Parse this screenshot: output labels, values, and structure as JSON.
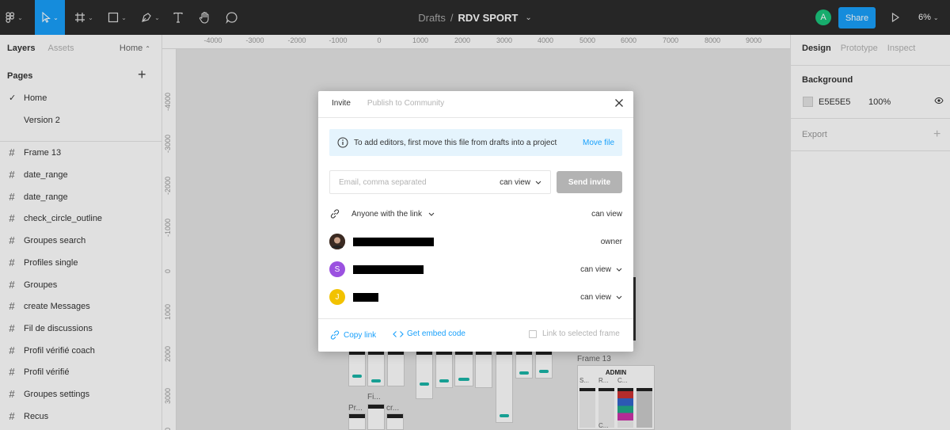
{
  "toolbar": {
    "breadcrumb_parent": "Drafts",
    "breadcrumb_sep": "/",
    "file_name": "RDV SPORT",
    "user_initial": "A",
    "share_label": "Share",
    "zoom": "6%"
  },
  "left_panel": {
    "tabs": [
      "Layers",
      "Assets"
    ],
    "page_selector": "Home",
    "pages_heading": "Pages",
    "pages": [
      "Home",
      "Version 2"
    ],
    "layers": [
      "Frame 13",
      "date_range",
      "date_range",
      "check_circle_outline",
      "Groupes search",
      "Profiles single",
      "Groupes",
      "create Messages",
      "Fil de discussions",
      "Profil vérifié coach",
      "Profil vérifié",
      "Groupes settings",
      "Recus"
    ]
  },
  "canvas": {
    "ruler_top": [
      "-4000",
      "-3000",
      "-2000",
      "-1000",
      "0",
      "1000",
      "2000",
      "3000",
      "4000",
      "5000",
      "6000",
      "7000",
      "8000",
      "9000"
    ],
    "ruler_left": [
      "-4000",
      "-3000",
      "-2000",
      "-1000",
      "0",
      "1000",
      "2000",
      "3000",
      "4000"
    ],
    "frame_label": "Frame 13",
    "admin_label": "ADMIN",
    "thumb_labels": [
      "Fi...",
      "Pr...",
      "cr...",
      "S...",
      "R...",
      "C...",
      "C..."
    ]
  },
  "right_panel": {
    "tabs": [
      "Design",
      "Prototype",
      "Inspect"
    ],
    "background_heading": "Background",
    "bg_hex": "E5E5E5",
    "bg_opacity": "100%",
    "export_heading": "Export"
  },
  "modal": {
    "tab_invite": "Invite",
    "tab_publish": "Publish to Community",
    "notice_text": "To add editors, first move this file from drafts into a project",
    "move_file": "Move file",
    "email_placeholder": "Email, comma separated",
    "invite_permission": "can view",
    "send_invite": "Send invite",
    "link_access": "Anyone with the link",
    "link_permission": "can view",
    "users": [
      {
        "initial": "",
        "role": "owner",
        "color": "#5a3a2a"
      },
      {
        "initial": "S",
        "role": "can view",
        "color": "#9b51e0"
      },
      {
        "initial": "J",
        "role": "can view",
        "color": "#f2c200"
      }
    ],
    "copy_link": "Copy link",
    "embed_code": "Get embed code",
    "link_frame": "Link to selected frame"
  }
}
